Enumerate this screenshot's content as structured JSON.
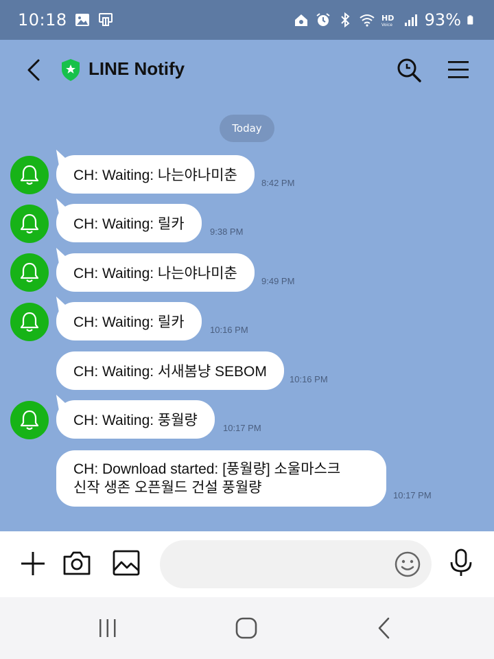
{
  "status_bar": {
    "time": "10:18",
    "battery": "93%",
    "icons": [
      "gallery-icon",
      "cast-icon",
      "home-sync-icon",
      "alarm-icon",
      "bluetooth-icon",
      "wifi-icon",
      "hd-voice-icon",
      "signal-icon",
      "battery-icon"
    ]
  },
  "header": {
    "title": "LINE Notify",
    "icons": [
      "back-icon",
      "shield-star-icon",
      "search-icon",
      "menu-icon"
    ]
  },
  "date_separator": "Today",
  "messages": [
    {
      "text": "CH: Waiting: 나는야나미춘",
      "time": "8:42 PM",
      "has_avatar": true
    },
    {
      "text": "CH: Waiting: 릴카",
      "time": "9:38 PM",
      "has_avatar": true
    },
    {
      "text": "CH: Waiting: 나는야나미춘",
      "time": "9:49 PM",
      "has_avatar": true
    },
    {
      "text": "CH: Waiting: 릴카",
      "time": "10:16 PM",
      "has_avatar": true
    },
    {
      "text": "CH: Waiting: 서새봄냥 SEBOM",
      "time": "10:16 PM",
      "has_avatar": false
    },
    {
      "text": "CH: Waiting: 풍월량",
      "time": "10:17 PM",
      "has_avatar": true
    },
    {
      "text_line1": "CH: Download started: [풍월량] 소울마스크",
      "text_line2": "신작  생존 오픈월드 건설 풍월량",
      "time": "10:17 PM",
      "has_avatar": false
    }
  ],
  "input_bar": {
    "placeholder": "",
    "icons": [
      "plus-icon",
      "camera-icon",
      "image-icon",
      "emoji-icon",
      "microphone-icon"
    ]
  },
  "nav_bar": {
    "icons": [
      "recent-apps-icon",
      "home-icon",
      "back-nav-icon"
    ]
  },
  "colors": {
    "chat_background": "#8aabda",
    "status_bar": "#5d7aa3",
    "avatar_green": "#17b317",
    "bubble": "#ffffff"
  }
}
